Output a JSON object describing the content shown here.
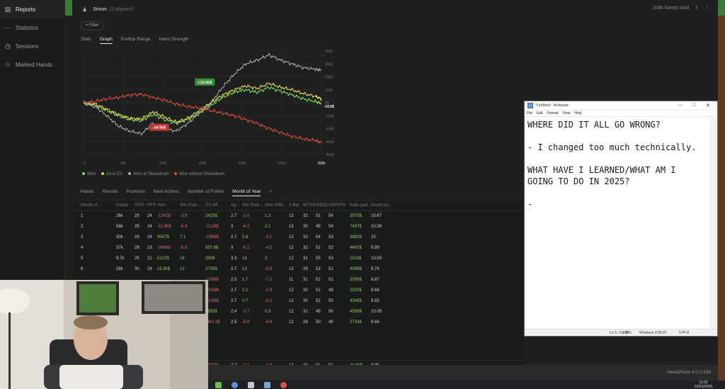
{
  "sidebar": {
    "items": [
      {
        "label": "Reports",
        "icon": "reports-icon",
        "glyph": "▤"
      },
      {
        "label": "Statistics",
        "icon": "statistics-icon",
        "glyph": "⋯"
      },
      {
        "label": "Sessions",
        "icon": "sessions-icon",
        "glyph": "◷"
      },
      {
        "label": "Marked Hands",
        "icon": "star-icon",
        "glyph": "☆"
      }
    ]
  },
  "header": {
    "player_icon": "player-icon",
    "player_glyph": "♟",
    "title": "Simon",
    "players": "(2 players)",
    "hands_total": "308k hands total"
  },
  "filter": {
    "label": "+ Filter"
  },
  "top_tabs": [
    "Stats",
    "Graph",
    "Preflop Range",
    "Hand Strength"
  ],
  "chart_data": {
    "type": "line",
    "x": [
      0,
      15,
      30,
      45,
      60,
      75,
      90,
      105,
      120,
      135,
      150,
      165,
      180,
      195,
      210,
      225,
      240,
      255,
      270,
      285,
      300,
      308
    ],
    "x_ticks": [
      "0",
      "50k",
      "100k",
      "150k",
      "200k",
      "250k",
      "308k"
    ],
    "y_ticks": [
      "40k$",
      "30k$",
      "20k$",
      "10k$",
      "0$",
      "-10k$",
      "-20k$",
      "-30k$",
      "-40k$"
    ],
    "ylim": [
      -40000,
      40000
    ],
    "series": [
      {
        "name": "Won",
        "color": "#7ed957",
        "values": [
          0,
          -2000,
          -6000,
          -10000,
          -13000,
          -14000,
          -9000,
          -13000,
          -16000,
          -13000,
          -8000,
          -2000,
          4000,
          8000,
          10000,
          8000,
          12000,
          9000,
          6000,
          3000,
          1000,
          -619
        ]
      },
      {
        "name": "All-in EV",
        "color": "#e5d94a",
        "values": [
          0,
          -1000,
          -5000,
          -9000,
          -12000,
          -12500,
          -7000,
          -11000,
          -15000,
          -12000,
          -6000,
          0,
          6000,
          10000,
          13000,
          11000,
          15000,
          12000,
          10000,
          7000,
          5000,
          3000
        ]
      },
      {
        "name": "Won at Showdown",
        "color": "#a8a8a8",
        "values": [
          0,
          -3000,
          -10000,
          -18000,
          -22000,
          -24000,
          -16000,
          -20000,
          -22000,
          -16000,
          -8000,
          0,
          12000,
          22000,
          30000,
          33000,
          37000,
          33000,
          30000,
          27000,
          26000,
          25000
        ]
      },
      {
        "name": "Won without Showdown",
        "color": "#e0493e",
        "values": [
          0,
          1000,
          3000,
          4000,
          6000,
          6500,
          4000,
          2000,
          -1000,
          -3000,
          -4000,
          -6000,
          -8000,
          -10000,
          -13000,
          -16000,
          -20000,
          -23000,
          -26000,
          -28000,
          -29000,
          -31000
        ]
      }
    ],
    "annotations": [
      {
        "text": "+12.6k$",
        "x": 157,
        "y": 16000,
        "color": "#3c8f3a"
      },
      {
        "text": "-16.5k$",
        "x": 98,
        "y": -19000,
        "color": "#b93a36"
      }
    ],
    "end_label": "-619$",
    "grid": true,
    "legend_placement": "bottom-left"
  },
  "table_tabs": [
    "Hands",
    "Results",
    "Positions",
    "Next Actions",
    "Number of Fishes",
    "Month of Year",
    "+"
  ],
  "table": {
    "columns": [
      "Month of ...",
      "Hands",
      "VPIP",
      "PFR",
      "Won",
      "Win Rate ...",
      "EV diff.",
      "Ag.",
      "Win Rate ...",
      "Won With...",
      "3-Bet",
      "WTSD",
      "W$SD",
      "WWSF%",
      "Rate paid",
      "Dispersio..."
    ],
    "rows": [
      [
        "1",
        "26k",
        "29",
        "24",
        "-1242$",
        "-3.9",
        "2425$",
        "2.7",
        "-2.6",
        "1.2",
        "13",
        "32",
        "51",
        "54",
        "3575$",
        "10.67"
      ],
      [
        "2",
        "58k",
        "29",
        "24",
        "-11.8k$",
        "-5.8",
        "-2126$",
        "3",
        "-6.2",
        "2.1",
        "13",
        "30",
        "49",
        "54",
        "7497$",
        "10.39"
      ],
      [
        "3",
        "30k",
        "29",
        "24",
        "9587$",
        "7.1",
        "-1986$",
        "2.7",
        "5.8",
        "-3.1",
        "12",
        "33",
        "54",
        "53",
        "3882$",
        "10"
      ],
      [
        "4",
        "37k",
        "28",
        "23",
        "-9488$",
        "-6.6",
        "657.6$",
        "3",
        "-6.1",
        "-4.5",
        "12",
        "32",
        "52",
        "52",
        "4492$",
        "9.99"
      ],
      [
        "5",
        "9.7k",
        "25",
        "21",
        "5122$",
        "16",
        "356$",
        "3.3",
        "18",
        "2",
        "12",
        "31",
        "55",
        "53",
        "1151$",
        "10.03"
      ],
      [
        "6",
        "28k",
        "30",
        "24",
        "15.8k$",
        "12",
        "2735$",
        "2.7",
        "13",
        "-5.9",
        "12",
        "29",
        "53",
        "51",
        "4098$",
        "9.74"
      ],
      [
        "",
        "",
        "",
        "",
        "",
        "",
        "-2286$",
        "2.5",
        "1.7",
        "-7.2",
        "11",
        "31",
        "51",
        "51",
        "5008$",
        "8.87"
      ],
      [
        "",
        "",
        "",
        "",
        "",
        "",
        "-2558$",
        "2.7",
        "2.2",
        "-2.9",
        "12",
        "30",
        "51",
        "49",
        "2320$",
        "9.68"
      ],
      [
        "",
        "",
        "",
        "",
        "",
        "",
        "-2148$",
        "2.7",
        "0.7",
        "-8.2",
        "12",
        "30",
        "52",
        "50",
        "4348$",
        "9.83"
      ],
      [
        "",
        "",
        "",
        "",
        "",
        "",
        "1659$",
        "2.4",
        "-3.7",
        "0.3",
        "12",
        "31",
        "49",
        "50",
        "4558$",
        "10.05"
      ],
      [
        "",
        "",
        "",
        "",
        "",
        "",
        "-962.1$",
        "2.5",
        "-5.9",
        "-4.9",
        "12",
        "28",
        "50",
        "49",
        "2734$",
        "9.66"
      ]
    ],
    "total": [
      "",
      "",
      "",
      "",
      "",
      "",
      "-4987$",
      "2.7",
      "-0.1",
      "-2.6",
      "12",
      "30",
      "51",
      "51",
      "44.8k$",
      "9.95"
    ]
  },
  "notepad": {
    "title": "*Untitled - Notepad",
    "menu": [
      "File",
      "Edit",
      "Format",
      "View",
      "Help"
    ],
    "text": "WHERE DID IT ALL GO WRONG?\n\n- I changed too much technically.\n\nWHAT HAVE I LEARNED/WHAT AM I\nGOING TO DO IN 2025?\n\n-",
    "status": {
      "position": "Ln 3, Col 35",
      "zoom": "100%",
      "eol": "Windows (CRLF)",
      "encoding": "UTF-8"
    }
  },
  "app_version": "Hand2Note 4.0.0.156",
  "clock": {
    "time": "11:02",
    "date": "01/01/2025"
  }
}
